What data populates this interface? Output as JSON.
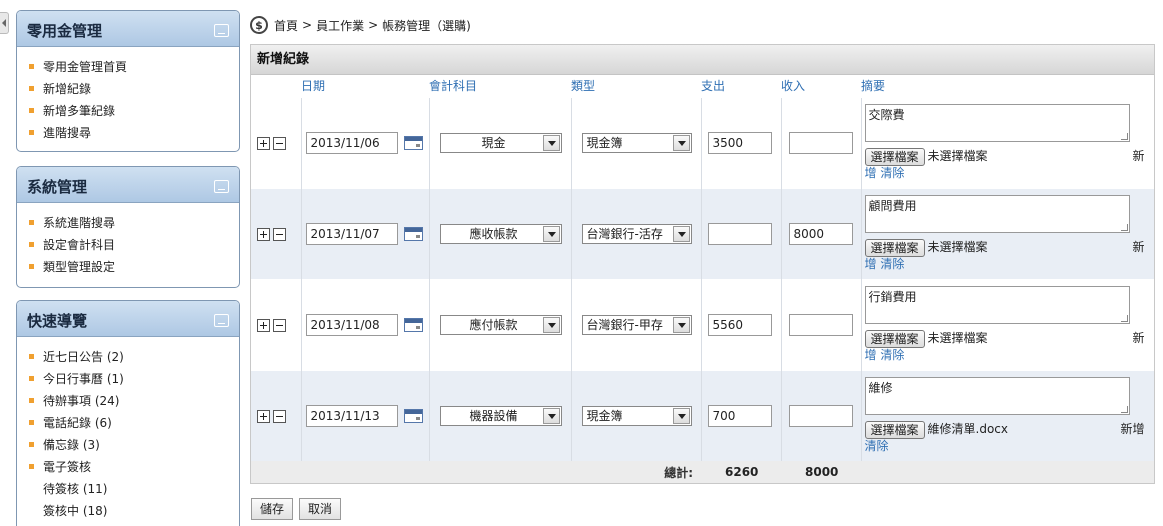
{
  "sidebar": {
    "panels": [
      {
        "title": "零用金管理",
        "items": [
          {
            "label": "零用金管理首頁"
          },
          {
            "label": "新增紀錄"
          },
          {
            "label": "新增多筆紀錄"
          },
          {
            "label": "進階搜尋"
          }
        ]
      },
      {
        "title": "系統管理",
        "items": [
          {
            "label": "系統進階搜尋"
          },
          {
            "label": "設定會計科目"
          },
          {
            "label": "類型管理設定"
          }
        ]
      },
      {
        "title": "快速導覽",
        "items": [
          {
            "label": "近七日公告 (2)"
          },
          {
            "label": "今日行事曆 (1)"
          },
          {
            "label": "待辦事項 (24)"
          },
          {
            "label": "電話紀錄 (6)"
          },
          {
            "label": "備忘錄 (3)"
          },
          {
            "label": "電子簽核"
          },
          {
            "label": "待簽核 (11)"
          },
          {
            "label": "簽核中 (18)"
          }
        ]
      }
    ]
  },
  "breadcrumb": {
    "home": "首頁",
    "sep1": ">",
    "section": "員工作業",
    "sep2": ">",
    "page": "帳務管理（選購)"
  },
  "form": {
    "title": "新增紀錄",
    "columns": {
      "date": "日期",
      "account": "會計科目",
      "type": "類型",
      "expense": "支出",
      "income": "收入",
      "memo": "摘要"
    },
    "rows": [
      {
        "date": "2013/11/06",
        "account": "現金",
        "type": "現金簿",
        "expense": "3500",
        "income": "",
        "memo": "交際費",
        "file_button": "選擇檔案",
        "file_name": "未選擇檔案",
        "add": "新",
        "add_cont": "增",
        "clear": "清除"
      },
      {
        "date": "2013/11/07",
        "account": "應收帳款",
        "type": "台灣銀行-活存",
        "expense": "",
        "income": "8000",
        "memo": "顧問費用",
        "file_button": "選擇檔案",
        "file_name": "未選擇檔案",
        "add": "新",
        "add_cont": "增",
        "clear": "清除"
      },
      {
        "date": "2013/11/08",
        "account": "應付帳款",
        "type": "台灣銀行-甲存",
        "expense": "5560",
        "income": "",
        "memo": "行銷費用",
        "file_button": "選擇檔案",
        "file_name": "未選擇檔案",
        "add": "新",
        "add_cont": "增",
        "clear": "清除"
      },
      {
        "date": "2013/11/13",
        "account": "機器設備",
        "type": "現金簿",
        "expense": "700",
        "income": "",
        "memo": "維修",
        "file_button": "選擇檔案",
        "file_name": "維修清單.docx",
        "add": "新增",
        "add_cont": "",
        "clear": "清除"
      }
    ],
    "total": {
      "label": "總計:",
      "expense": "6260",
      "income": "8000"
    }
  },
  "actions": {
    "save": "儲存",
    "cancel": "取消"
  },
  "colors": {
    "panel_header": "#aec8e4",
    "link_blue": "#2f6fb3",
    "bullet": "#f0a030",
    "alt_row": "#e9eef5"
  }
}
